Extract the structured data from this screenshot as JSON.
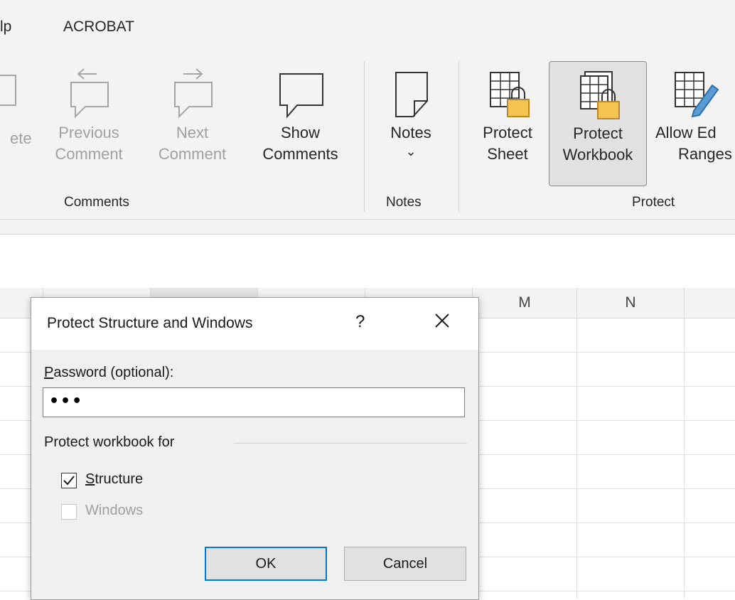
{
  "menubar": {
    "tabs": [
      "lp",
      "ACROBAT"
    ]
  },
  "ribbon": {
    "groups": {
      "comments": {
        "label": "Comments",
        "buttons": {
          "delete_partial": "ete",
          "previous": [
            "Previous",
            "Comment"
          ],
          "next": [
            "Next",
            "Comment"
          ],
          "show": [
            "Show",
            "Comments"
          ]
        }
      },
      "notes": {
        "label": "Notes",
        "button": "Notes",
        "dropdown_glyph": "⌄"
      },
      "protect": {
        "label": "Protect",
        "buttons": {
          "protect_sheet": [
            "Protect",
            "Sheet"
          ],
          "protect_workbook": [
            "Protect",
            "Workbook"
          ],
          "allow_edit": [
            "Allow Ed",
            "Ranges"
          ]
        }
      }
    }
  },
  "sheet": {
    "columns": [
      "M",
      "N"
    ]
  },
  "dialog": {
    "title": "Protect Structure and Windows",
    "help": "?",
    "password_label": {
      "accel": "P",
      "rest": "assword (optional):"
    },
    "password_value": "•••",
    "group_label": "Protect workbook for",
    "structure": {
      "accel": "S",
      "rest": "tructure",
      "checked": true
    },
    "windows": {
      "label": "Windows",
      "checked": false,
      "disabled": true
    },
    "ok_label": "OK",
    "cancel_label": "Cancel"
  }
}
